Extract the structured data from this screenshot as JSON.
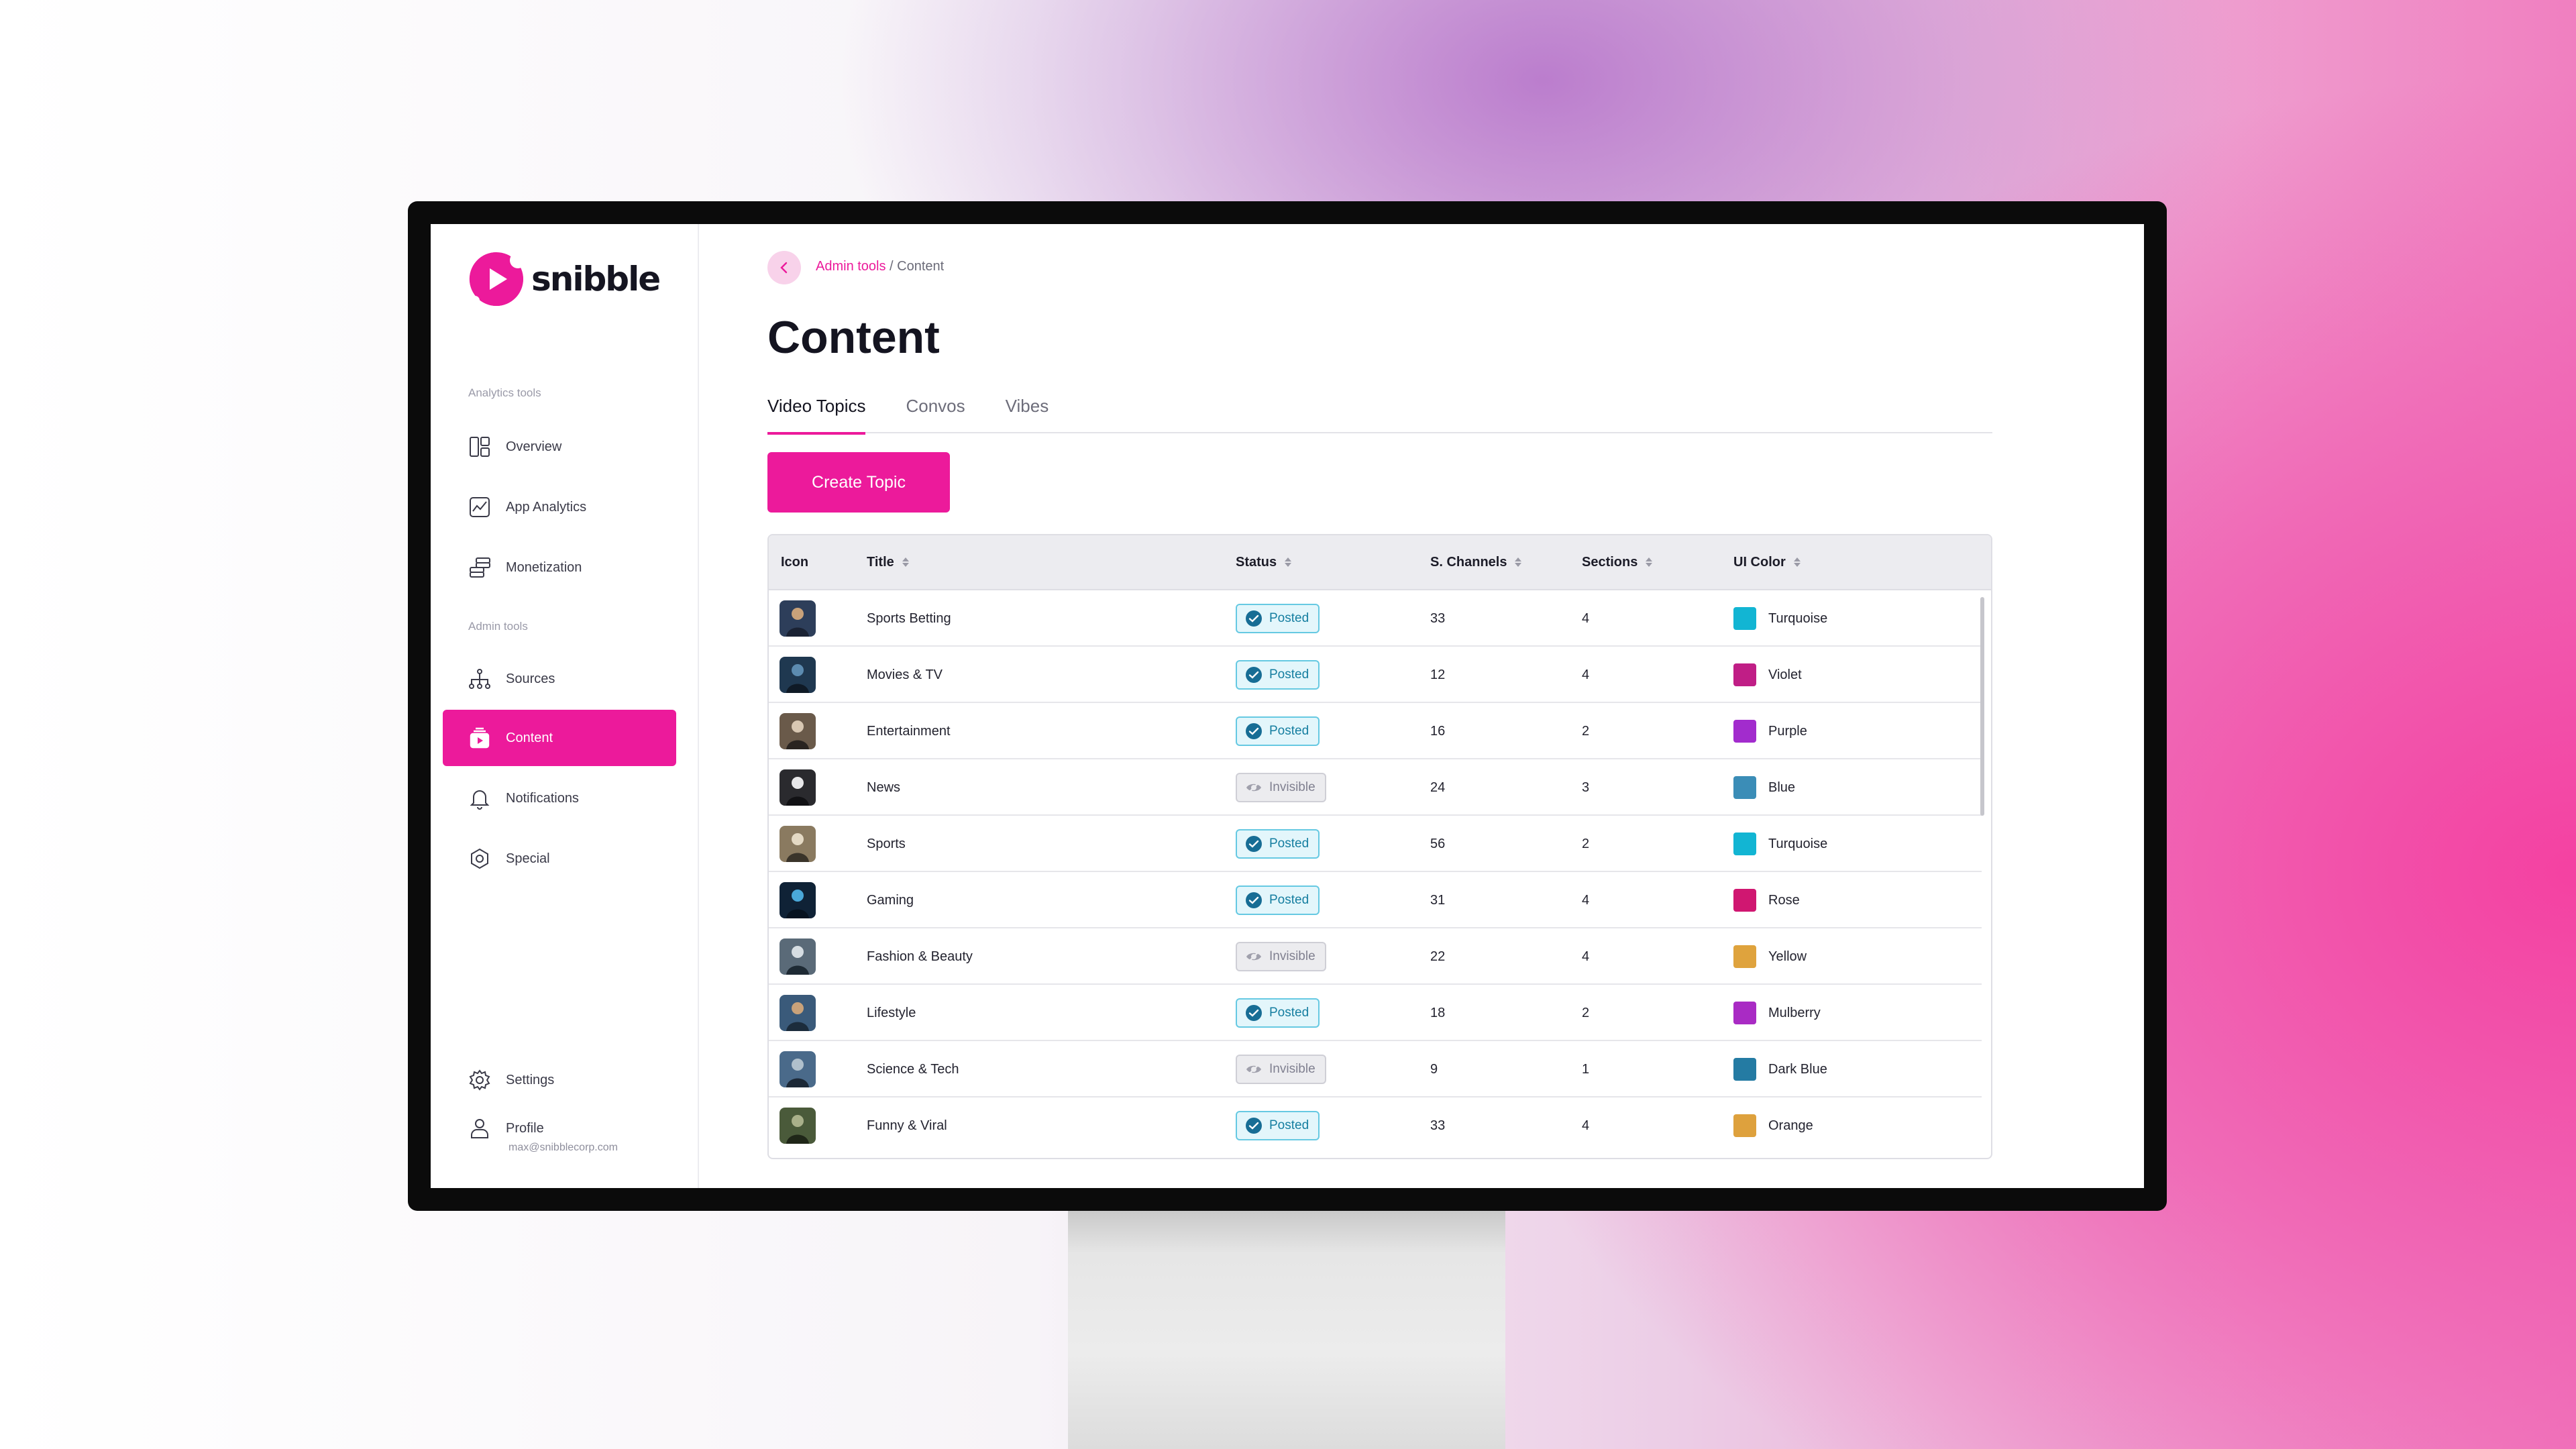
{
  "app": {
    "logo_text": "snibble"
  },
  "sidebar": {
    "analytics_label": "Analytics tools",
    "admin_label": "Admin tools",
    "items": [
      {
        "label": "Overview",
        "icon": "layout-icon"
      },
      {
        "label": "App Analytics",
        "icon": "chart-icon"
      },
      {
        "label": "Monetization",
        "icon": "coins-icon"
      },
      {
        "label": "Sources",
        "icon": "hierarchy-icon"
      },
      {
        "label": "Content",
        "icon": "content-icon",
        "active": true
      },
      {
        "label": "Notifications",
        "icon": "bell-icon"
      },
      {
        "label": "Special",
        "icon": "hexagon-icon"
      },
      {
        "label": "Settings",
        "icon": "gear-icon"
      },
      {
        "label": "Profile",
        "icon": "user-icon"
      }
    ],
    "profile_email": "max@snibblecorp.com"
  },
  "breadcrumb": {
    "parent": "Admin tools",
    "separator": " / ",
    "current": "Content"
  },
  "page": {
    "title": "Content",
    "tabs": [
      "Video Topics",
      "Convos",
      "Vibes"
    ],
    "active_tab": "Video Topics",
    "create_button": "Create Topic"
  },
  "table": {
    "columns": [
      "Icon",
      "Title",
      "Status",
      "S. Channels",
      "Sections",
      "UI Color"
    ],
    "rows": [
      {
        "title": "Sports Betting",
        "status": "Posted",
        "channels": "33",
        "sections": "4",
        "color_name": "Turquoise",
        "color": "#12b5d3"
      },
      {
        "title": "Movies & TV",
        "status": "Posted",
        "channels": "12",
        "sections": "4",
        "color_name": "Violet",
        "color": "#c01e86"
      },
      {
        "title": "Entertainment",
        "status": "Posted",
        "channels": "16",
        "sections": "2",
        "color_name": "Purple",
        "color": "#a22ccd"
      },
      {
        "title": "News",
        "status": "Invisible",
        "channels": "24",
        "sections": "3",
        "color_name": "Blue",
        "color": "#3b8db7"
      },
      {
        "title": "Sports",
        "status": "Posted",
        "channels": "56",
        "sections": "2",
        "color_name": "Turquoise",
        "color": "#12b5d3"
      },
      {
        "title": "Gaming",
        "status": "Posted",
        "channels": "31",
        "sections": "4",
        "color_name": "Rose",
        "color": "#d01771"
      },
      {
        "title": "Fashion & Beauty",
        "status": "Invisible",
        "channels": "22",
        "sections": "4",
        "color_name": "Yellow",
        "color": "#dfa33d"
      },
      {
        "title": "Lifestyle",
        "status": "Posted",
        "channels": "18",
        "sections": "2",
        "color_name": "Mulberry",
        "color": "#a92bc4"
      },
      {
        "title": "Science & Tech",
        "status": "Invisible",
        "channels": "9",
        "sections": "1",
        "color_name": "Dark Blue",
        "color": "#247ba3"
      },
      {
        "title": "Funny & Viral",
        "status": "Posted",
        "channels": "33",
        "sections": "4",
        "color_name": "Orange",
        "color": "#dea13d"
      }
    ]
  },
  "colors": {
    "accent": "#ec1a9b",
    "posted": "#157ea0",
    "invisible": "#808090"
  }
}
